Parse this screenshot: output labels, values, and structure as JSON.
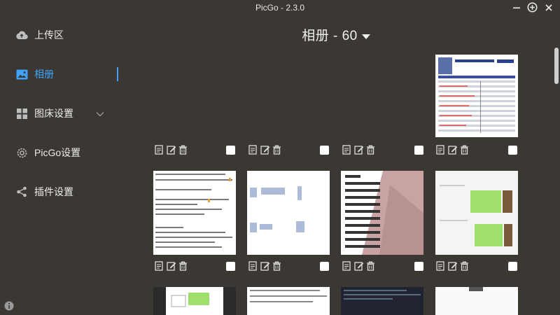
{
  "window": {
    "title": "PicGo - 2.3.0"
  },
  "sidebar": {
    "items": [
      {
        "label": "上传区",
        "icon": "upload-cloud-icon"
      },
      {
        "label": "相册",
        "icon": "image-icon",
        "active": true
      },
      {
        "label": "图床设置",
        "icon": "grid-icon"
      },
      {
        "label": "PicGo设置",
        "icon": "gear-icon"
      },
      {
        "label": "插件设置",
        "icon": "share-icon"
      }
    ]
  },
  "album": {
    "title": "相册 - 60"
  },
  "colors": {
    "accent": "#3fa3ff",
    "background": "#3b3834"
  },
  "gallery": {
    "images": [
      {
        "kind": "table-doc"
      },
      {
        "kind": "text-notes"
      },
      {
        "kind": "blurred-text"
      },
      {
        "kind": "list-photo"
      },
      {
        "kind": "green-slides"
      },
      {
        "kind": "doc-top"
      },
      {
        "kind": "doc-top"
      },
      {
        "kind": "screenshot-top"
      },
      {
        "kind": "white-top"
      }
    ],
    "item_actions": [
      "copy-icon",
      "edit-icon",
      "delete-icon"
    ]
  }
}
